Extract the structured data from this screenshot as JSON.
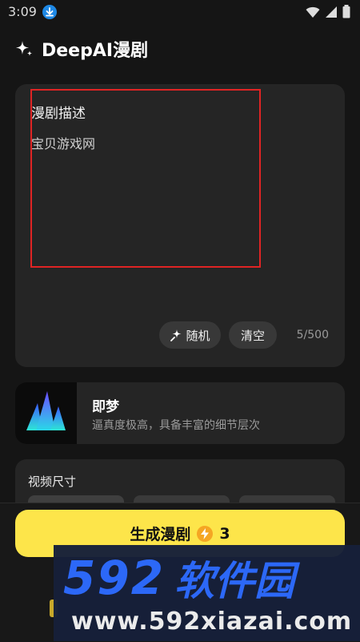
{
  "status_bar": {
    "time": "3:09"
  },
  "header": {
    "title": "DeepAI漫剧",
    "icon": "sparkle-icon"
  },
  "description": {
    "label": "漫剧描述",
    "value": "宝贝游戏网",
    "random_label": "随机",
    "clear_label": "清空",
    "counter": "5/500"
  },
  "model": {
    "name": "即梦",
    "description": "逼真度极高，具备丰富的细节层次"
  },
  "video_size": {
    "label": "视频尺寸"
  },
  "generate": {
    "label": "生成漫剧",
    "cost": "3"
  },
  "watermark": {
    "digits": "592",
    "chinese": "软件园",
    "url": "www.592xiazai.com"
  },
  "colors": {
    "accent_yellow": "#fde54a",
    "card_bg": "#252525",
    "annotation_red": "#e02424",
    "watermark_blue": "#2d6bff"
  }
}
